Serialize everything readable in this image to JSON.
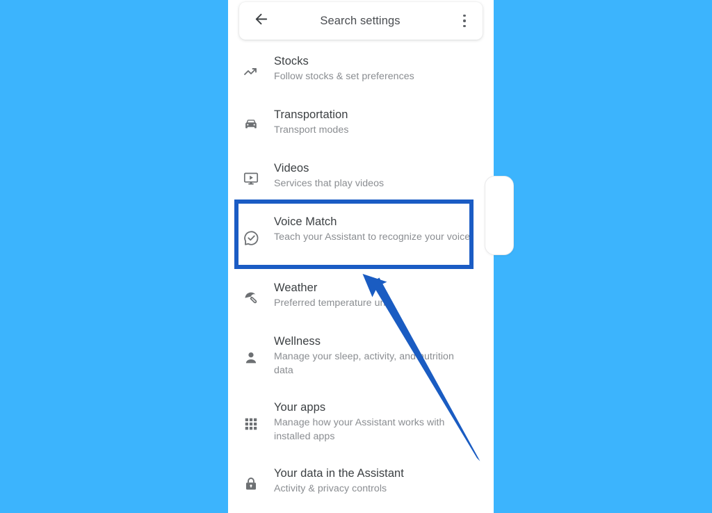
{
  "window": {
    "background_color": "#3cb4fd",
    "panel_background": "#ffffff"
  },
  "header": {
    "back_icon": "arrow-left-icon",
    "title": "Search settings",
    "overflow_icon": "more-vertical-icon"
  },
  "annotation": {
    "highlight_color": "#1b5cc4",
    "arrow_color": "#1a5cc2",
    "highlighted_item": "Voice Match"
  },
  "settings": {
    "items": [
      {
        "icon": "trending-up-icon",
        "title": "Stocks",
        "subtitle": "Follow stocks & set preferences",
        "highlighted": false
      },
      {
        "icon": "car-icon",
        "title": "Transportation",
        "subtitle": "Transport modes",
        "highlighted": false
      },
      {
        "icon": "video-monitor-icon",
        "title": "Videos",
        "subtitle": "Services that play videos",
        "highlighted": false
      },
      {
        "icon": "voice-match-check-icon",
        "title": "Voice Match",
        "subtitle": "Teach your Assistant to recognize your voice",
        "highlighted": true
      },
      {
        "icon": "beach-umbrella-icon",
        "title": "Weather",
        "subtitle": "Preferred temperature unit",
        "highlighted": false
      },
      {
        "icon": "person-icon",
        "title": "Wellness",
        "subtitle": "Manage your sleep, activity, and nutrition data",
        "highlighted": false
      },
      {
        "icon": "apps-grid-icon",
        "title": "Your apps",
        "subtitle": "Manage how your Assistant works with installed apps",
        "highlighted": false
      },
      {
        "icon": "lock-icon",
        "title": "Your data in the Assistant",
        "subtitle": "Activity & privacy controls",
        "highlighted": false
      }
    ]
  }
}
